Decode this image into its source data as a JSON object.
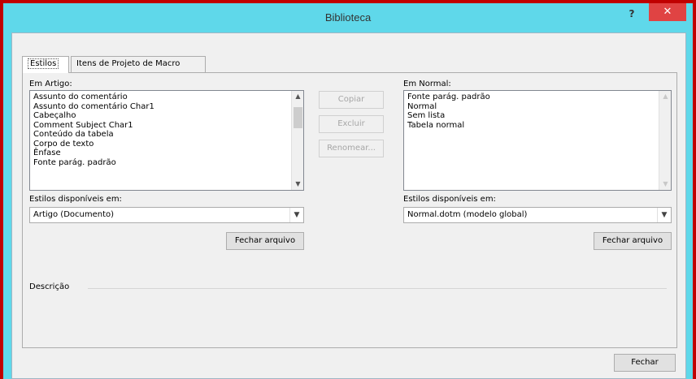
{
  "window": {
    "title": "Biblioteca",
    "help_label": "?",
    "close_label": "✕"
  },
  "tabs": [
    {
      "label": "Estilos",
      "active": true
    },
    {
      "label": "Itens de Projeto de Macro",
      "active": false
    }
  ],
  "left": {
    "list_label": "Em Artigo:",
    "items": [
      "Assunto do comentário",
      "Assunto do comentário Char1",
      "Cabeçalho",
      "Comment Subject Char1",
      "Conteúdo da tabela",
      "Corpo de texto",
      "Ênfase",
      "Fonte parág. padrão"
    ],
    "available_label": "Estilos disponíveis em:",
    "available_value": "Artigo (Documento)",
    "close_file_label": "Fechar arquivo"
  },
  "middle": {
    "copy_label": "Copiar",
    "delete_label": "Excluir",
    "rename_label": "Renomear..."
  },
  "right": {
    "list_label": "Em Normal:",
    "items": [
      "Fonte parág. padrão",
      "Normal",
      "Sem lista",
      "Tabela normal"
    ],
    "available_label": "Estilos disponíveis em:",
    "available_value": "Normal.dotm (modelo global)",
    "close_file_label": "Fechar arquivo"
  },
  "description": {
    "label": "Descrição"
  },
  "footer": {
    "close_label": "Fechar"
  },
  "icons": {
    "scroll_up": "▲",
    "scroll_down": "▼",
    "dropdown": "▼"
  },
  "colors": {
    "titlebar": "#5fd8ea",
    "close_button": "#e04343",
    "frame_border": "#c00000"
  }
}
